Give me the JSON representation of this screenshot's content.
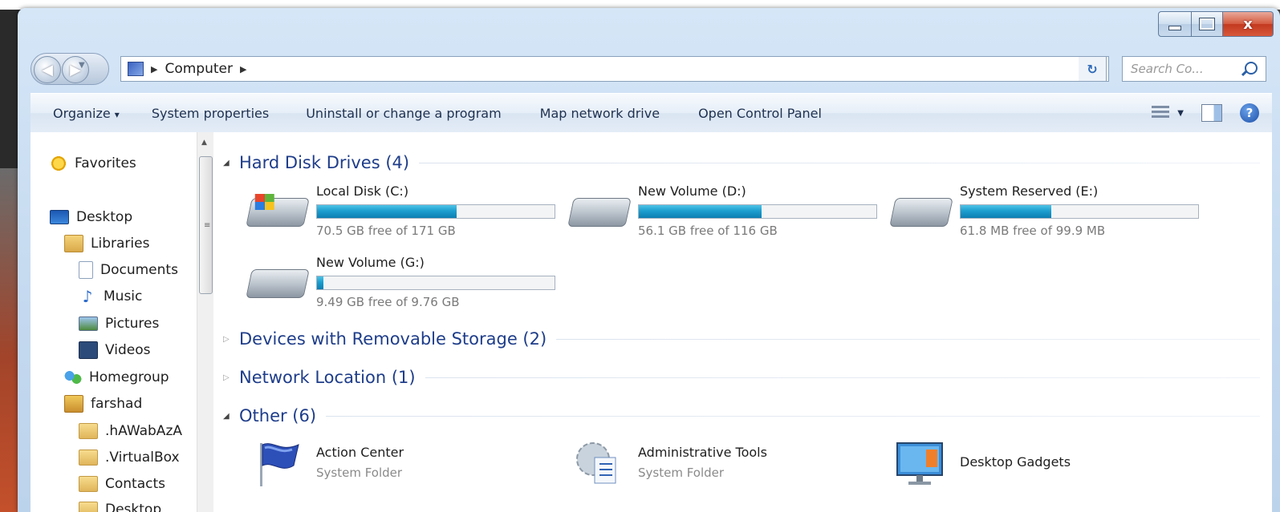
{
  "window": {
    "address": {
      "crumbs": [
        "Computer"
      ]
    },
    "search": {
      "placeholder": "Search Co..."
    },
    "caption": {
      "close_glyph": "x"
    }
  },
  "toolbar": {
    "items": [
      "Organize",
      "System properties",
      "Uninstall or change a program",
      "Map network drive",
      "Open Control Panel"
    ],
    "organize_caret": "▾"
  },
  "nav": {
    "items": [
      {
        "label": "Favorites",
        "icon": "star-icon"
      },
      {
        "label": "Desktop",
        "icon": "desktop-icon"
      },
      {
        "label": "Libraries",
        "icon": "libraries-icon"
      },
      {
        "label": "Documents",
        "icon": "documents-icon"
      },
      {
        "label": "Music",
        "icon": "music-icon"
      },
      {
        "label": "Pictures",
        "icon": "pictures-icon"
      },
      {
        "label": "Videos",
        "icon": "videos-icon"
      },
      {
        "label": "Homegroup",
        "icon": "homegroup-icon"
      },
      {
        "label": "farshad",
        "icon": "user-folder-icon"
      },
      {
        "label": ".hAWabAzA",
        "icon": "folder-icon"
      },
      {
        "label": ".VirtualBox",
        "icon": "folder-icon"
      },
      {
        "label": "Contacts",
        "icon": "folder-icon"
      },
      {
        "label": "Desktop",
        "icon": "folder-icon"
      }
    ]
  },
  "groups": {
    "hard_disks": "Hard Disk Drives (4)",
    "removable": "Devices with Removable Storage (2)",
    "network": "Network Location (1)",
    "other": "Other (6)"
  },
  "drives": [
    {
      "name": "Local Disk (C:)",
      "free": "70.5 GB free of 171 GB",
      "used_fraction": 0.588
    },
    {
      "name": "New Volume (D:)",
      "free": "56.1 GB free of 116 GB",
      "used_fraction": 0.516
    },
    {
      "name": "System Reserved (E:)",
      "free": "61.8 MB free of 99.9 MB",
      "used_fraction": 0.381
    },
    {
      "name": "New Volume (G:)",
      "free": "9.49 GB free of 9.76 GB",
      "used_fraction": 0.028
    }
  ],
  "other_items": [
    {
      "name": "Action Center",
      "sub": "System Folder",
      "icon": "action-center-flag-icon"
    },
    {
      "name": "Administrative Tools",
      "sub": "System Folder",
      "icon": "administrative-tools-icon"
    },
    {
      "name": "Desktop Gadgets",
      "sub": "",
      "icon": "desktop-gadgets-icon"
    }
  ],
  "colors": {
    "accent_heading": "#1e3d8a",
    "bar_fill": "#1c9fcf"
  }
}
